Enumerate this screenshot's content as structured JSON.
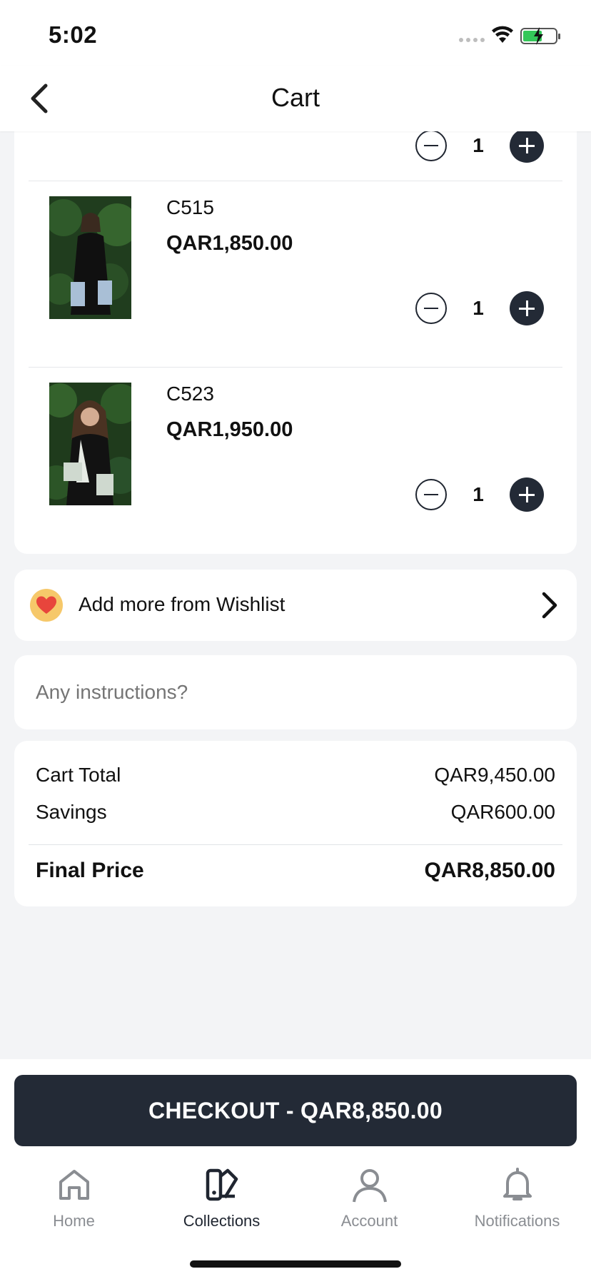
{
  "status_bar": {
    "time": "5:02"
  },
  "navbar": {
    "title": "Cart"
  },
  "cart": {
    "partial_item": {
      "quantity": "1"
    },
    "items": [
      {
        "name": "C515",
        "price": "QAR1,850.00",
        "quantity": "1"
      },
      {
        "name": "C523",
        "price": "QAR1,950.00",
        "quantity": "1"
      }
    ]
  },
  "wishlist": {
    "label": "Add more from Wishlist"
  },
  "instructions": {
    "placeholder": "Any instructions?"
  },
  "summary": {
    "cart_total_label": "Cart Total",
    "cart_total_value": "QAR9,450.00",
    "savings_label": "Savings",
    "savings_value": "QAR600.00",
    "final_label": "Final Price",
    "final_value": "QAR8,850.00"
  },
  "checkout": {
    "label": "CHECKOUT - QAR8,850.00"
  },
  "tabbar": {
    "tabs": [
      {
        "label": "Home",
        "icon": "home-icon",
        "active": false
      },
      {
        "label": "Collections",
        "icon": "collections-icon",
        "active": true
      },
      {
        "label": "Account",
        "icon": "account-icon",
        "active": false
      },
      {
        "label": "Notifications",
        "icon": "bell-icon",
        "active": false
      }
    ]
  },
  "colors": {
    "primary_dark": "#232a36",
    "background": "#f3f4f6",
    "wishlist_icon_bg": "#f6c86a",
    "heart": "#e8453c",
    "tab_inactive": "#8a8d92"
  }
}
